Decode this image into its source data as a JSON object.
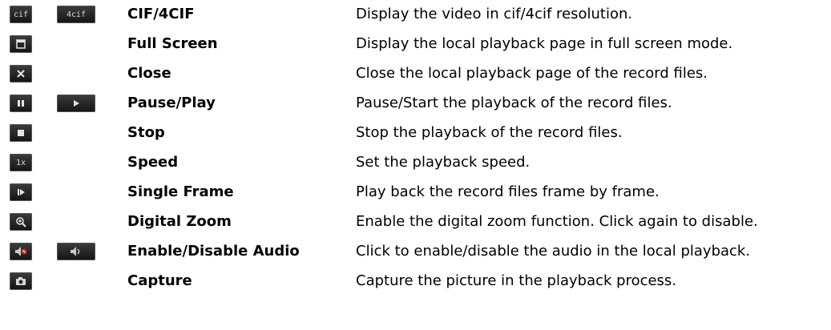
{
  "items": [
    {
      "name": "CIF/4CIF",
      "desc": "Display the video in cif/4cif resolution.",
      "icon1_text": "cif",
      "icon2_text": "4cif"
    },
    {
      "name": "Full Screen",
      "desc": "Display the local playback page in full screen mode."
    },
    {
      "name": "Close",
      "desc": "Close the local playback page of the record files."
    },
    {
      "name": "Pause/Play",
      "desc": "Pause/Start the playback of the record files."
    },
    {
      "name": "Stop",
      "desc": "Stop the playback of the record files."
    },
    {
      "name": "Speed",
      "desc": "Set the playback speed.",
      "icon1_text": "1x"
    },
    {
      "name": "Single Frame",
      "desc": "Play back the record files frame by frame."
    },
    {
      "name": "Digital Zoom",
      "desc": "Enable the digital zoom function. Click again to disable."
    },
    {
      "name": "Enable/Disable Audio",
      "desc": "Click to enable/disable the audio in the local playback."
    },
    {
      "name": "Capture",
      "desc": "Capture the picture in the playback process."
    }
  ]
}
